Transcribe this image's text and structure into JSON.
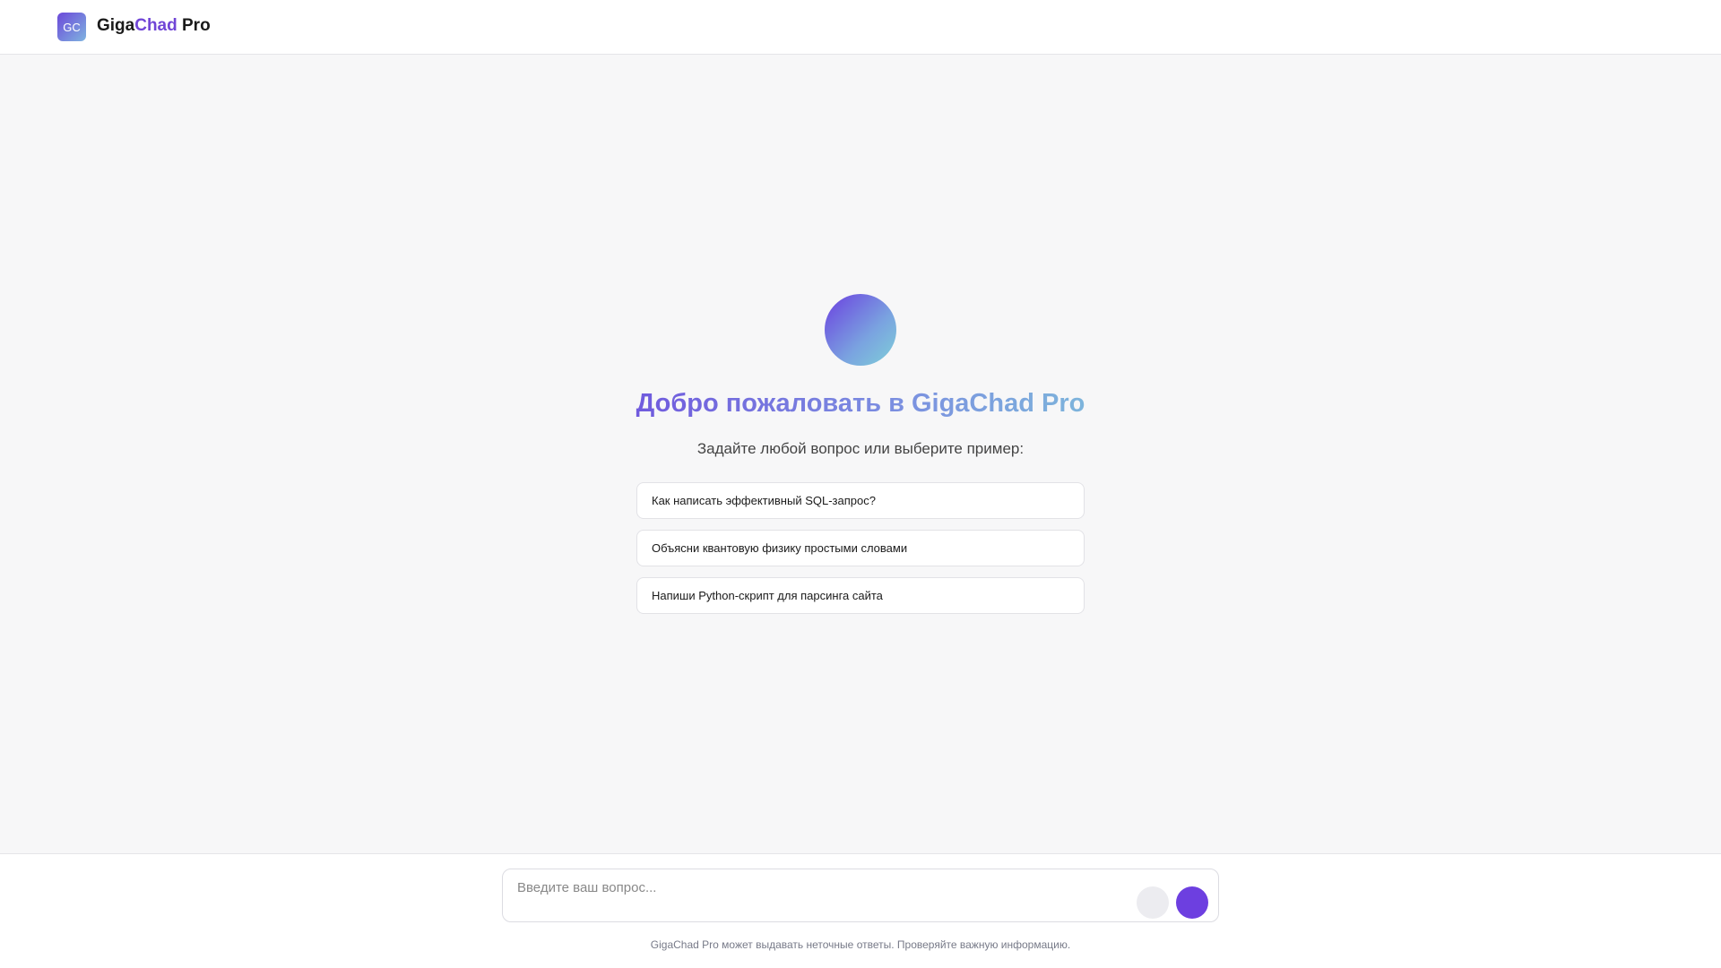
{
  "header": {
    "menu_icon": "",
    "logo_text": "GC",
    "brand_part1": "Giga",
    "brand_part2": "Chad",
    "brand_part3": " Pro",
    "settings_icon": ""
  },
  "hero": {
    "avatar_icon": "",
    "title": "Добро пожаловать в GigaChad Pro",
    "subtitle": "Задайте любой вопрос или выберите пример:"
  },
  "examples": [
    "Как написать эффективный SQL-запрос?",
    "Объясни квантовую физику простыми словами",
    "Напиши Python-скрипт для парсинга сайта"
  ],
  "composer": {
    "placeholder": "Введите ваш вопрос...",
    "attach_icon": "",
    "send_icon": ""
  },
  "footer": {
    "disclaimer": "GigaChad Pro может выдавать неточные ответы. Проверяйте важную информацию."
  },
  "colors": {
    "accent": "#6d3fe0",
    "gradient_start": "#6a3fdc",
    "gradient_end": "#7fcfd8"
  }
}
